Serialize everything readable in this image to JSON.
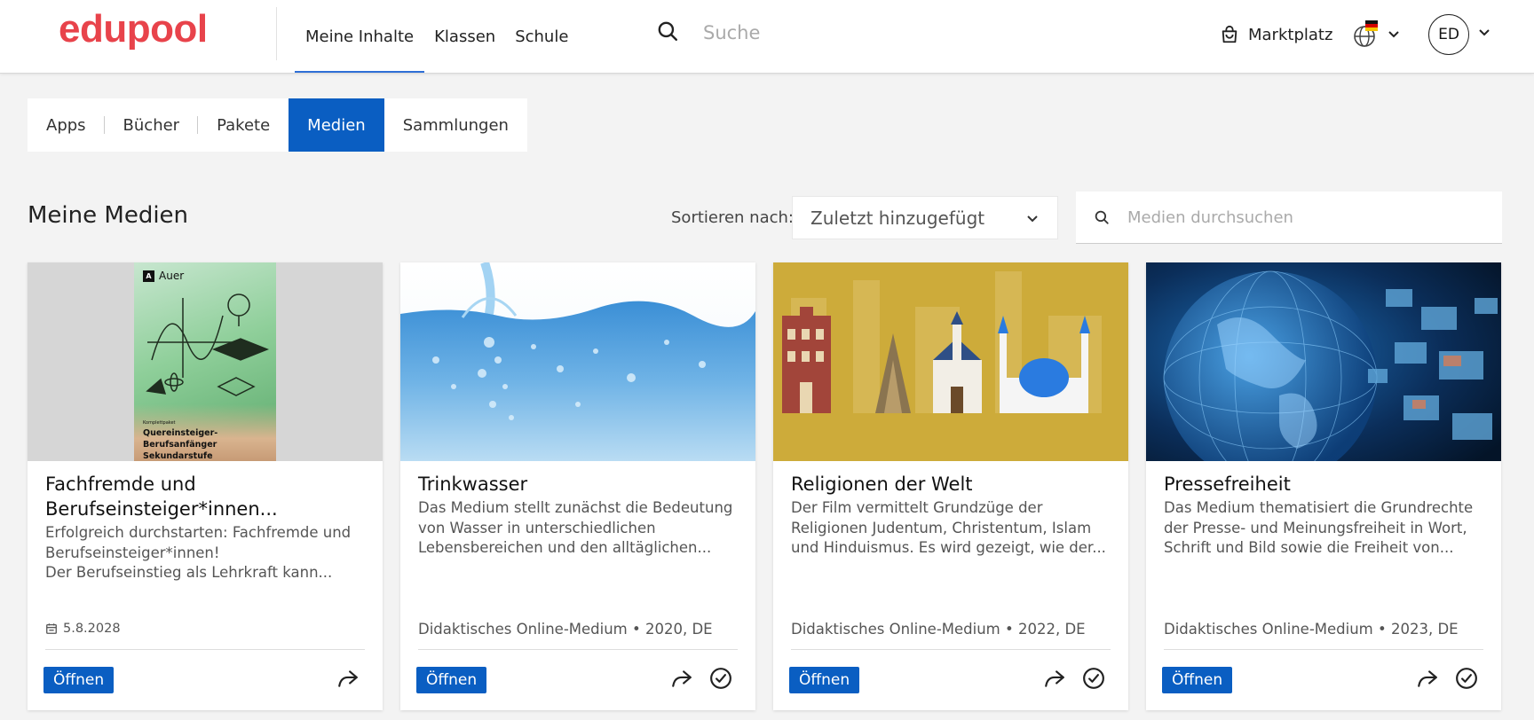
{
  "header": {
    "logo": "edupool",
    "nav": [
      {
        "label": "Meine Inhalte",
        "active": true
      },
      {
        "label": "Klassen",
        "active": false
      },
      {
        "label": "Schule",
        "active": false
      }
    ],
    "search_placeholder": "Suche",
    "marketplace": "Marktplatz",
    "avatar_initials": "ED"
  },
  "tabs": [
    {
      "label": "Apps",
      "active": false
    },
    {
      "label": "Bücher",
      "active": false
    },
    {
      "label": "Pakete",
      "active": false
    },
    {
      "label": "Medien",
      "active": true
    },
    {
      "label": "Sammlungen",
      "active": false
    }
  ],
  "section": {
    "title": "Meine Medien",
    "sort_label": "Sortieren nach:",
    "sort_value": "Zuletzt hinzugefügt",
    "search_placeholder": "Medien durchsuchen"
  },
  "cards": [
    {
      "title": "Fachfremde und Berufseinsteiger*innen...",
      "description": "Erfolgreich durchstarten: Fachfremde und Berufseinsteiger*innen!\nDer Berufseinstieg als Lehrkraft kann...",
      "date": "5.8.2028",
      "meta": "",
      "open_label": "Öffnen",
      "cover_publisher": "Auer",
      "cover_small": "Komplettpaket",
      "cover_title": "Quereinsteiger-Berufsanfänger Sekundarstufe"
    },
    {
      "title": "Trinkwasser",
      "description": "Das Medium stellt zunächst die Bedeutung von Wasser in unterschiedlichen Lebensbereichen und den alltäglichen...",
      "date": "",
      "meta": "Didaktisches Online-Medium • 2020, DE",
      "open_label": "Öffnen"
    },
    {
      "title": "Religionen der Welt",
      "description": "Der Film vermittelt Grundzüge der Religionen Judentum, Christentum, Islam und Hinduismus. Es wird gezeigt, wie der...",
      "date": "",
      "meta": "Didaktisches Online-Medium • 2022, DE",
      "open_label": "Öffnen"
    },
    {
      "title": "Pressefreiheit",
      "description": "Das Medium thematisiert die Grundrechte der Presse- und Meinungsfreiheit in Wort, Schrift und Bild sowie die Freiheit von...",
      "date": "",
      "meta": "Didaktisches Online-Medium • 2023, DE",
      "open_label": "Öffnen"
    }
  ],
  "colors": {
    "brand": "#e8434b",
    "accent": "#0a5ec2"
  }
}
